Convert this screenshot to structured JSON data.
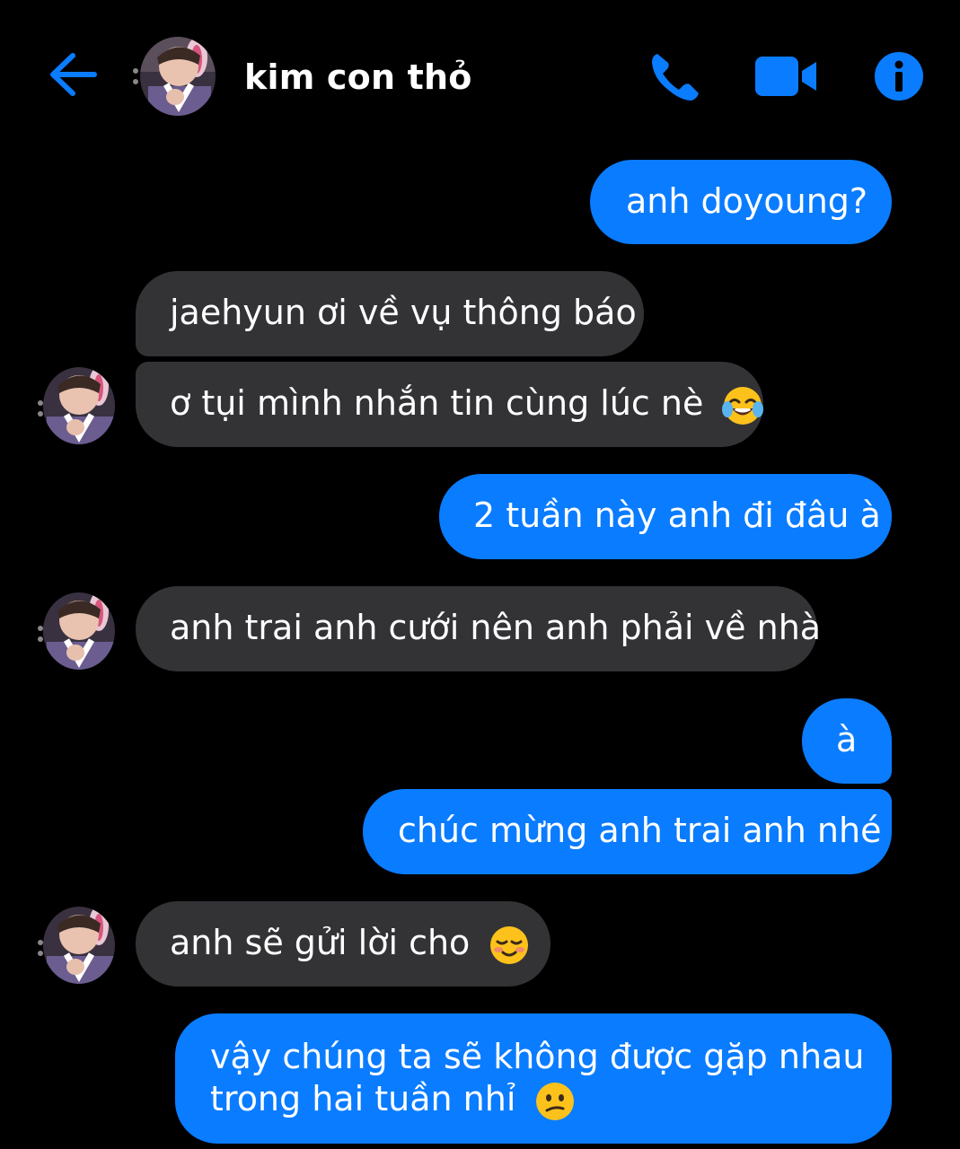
{
  "header": {
    "title": "kim con thỏ",
    "back_icon": "arrow-left-icon",
    "call_icon": "phone-icon",
    "video_icon": "video-camera-icon",
    "info_icon": "info-icon"
  },
  "colors": {
    "accent": "#0a7cff",
    "received_bubble": "#333336",
    "background": "#000000"
  },
  "messages": [
    {
      "from": "me",
      "text": "anh doyoung?"
    },
    {
      "from": "them",
      "text": "jaehyun ơi về vụ thông báo"
    },
    {
      "from": "them",
      "text": "ơ tụi mình nhắn tin cùng lúc nè",
      "emoji": "tears-of-joy-emoji"
    },
    {
      "from": "me",
      "text": "2 tuần này anh đi đâu à"
    },
    {
      "from": "them",
      "text": "anh trai anh cưới nên anh phải về nhà"
    },
    {
      "from": "me",
      "text": "à"
    },
    {
      "from": "me",
      "text": "chúc mừng anh trai anh nhé"
    },
    {
      "from": "them",
      "text": "anh sẽ gửi lời cho",
      "emoji": "smiling-blushing-emoji"
    },
    {
      "from": "me",
      "text_line1": "vậy chúng ta sẽ không được gặp nhau",
      "text_line2": "trong hai tuần nhỉ",
      "emoji": "confused-face-emoji"
    }
  ]
}
